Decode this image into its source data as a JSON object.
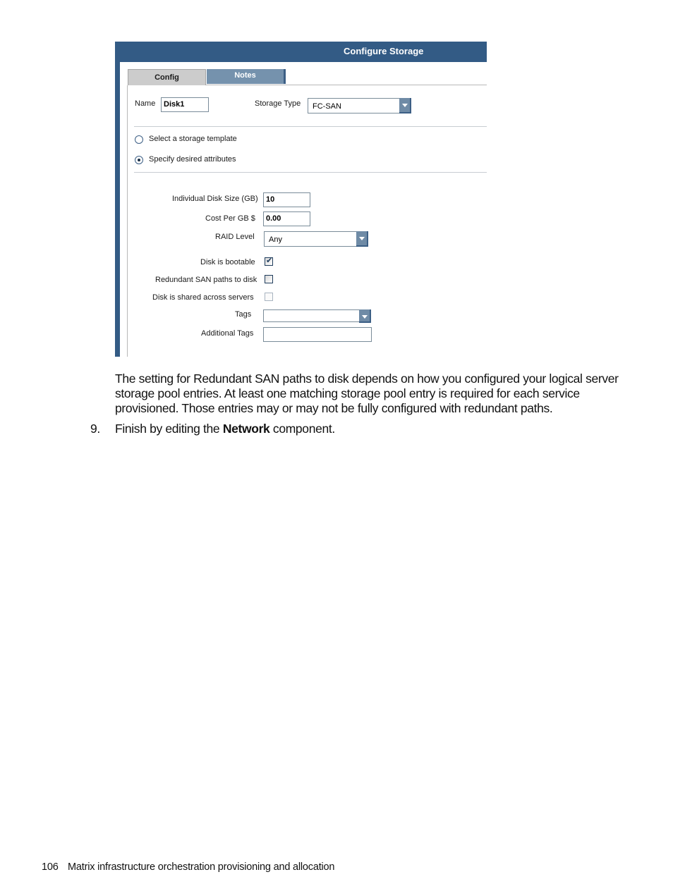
{
  "panel": {
    "title": "Configure Storage",
    "tabs": [
      {
        "label": "Config",
        "active": true
      },
      {
        "label": "Notes",
        "active": false
      }
    ],
    "name_label": "Name",
    "name_value": "Disk1",
    "storage_type_label": "Storage Type",
    "storage_type_value": "FC-SAN",
    "radios": [
      {
        "label": "Select a storage template",
        "selected": false
      },
      {
        "label": "Specify desired attributes",
        "selected": true
      }
    ],
    "disk_size_label": "Individual Disk Size (GB)",
    "disk_size_value": "10",
    "cost_label": "Cost Per GB $",
    "cost_value": "0.00",
    "raid_label": "RAID Level",
    "raid_value": "Any",
    "checkboxes": [
      {
        "label": "Disk is bootable",
        "checked": true,
        "enabled": true
      },
      {
        "label": "Redundant SAN paths to disk",
        "checked": false,
        "enabled": true
      },
      {
        "label": "Disk is shared across servers",
        "checked": false,
        "enabled": false
      }
    ],
    "tags_label": "Tags",
    "tags_value": "",
    "additional_tags_label": "Additional Tags",
    "additional_tags_value": ""
  },
  "document": {
    "paragraph": "The setting for Redundant SAN paths to disk depends on how you configured your logical server storage pool entries. At least one matching storage pool entry is required for each service provisioned. Those entries may or may not be fully configured with redundant paths.",
    "step_number": "9.",
    "step_prefix": "Finish by editing the ",
    "step_bold": "Network",
    "step_suffix": " component.",
    "footer_page": "106",
    "footer_title": "Matrix infrastructure orchestration provisioning and allocation"
  },
  "colors": {
    "header_blue": "#335b85",
    "notes_tab": "#7592ad",
    "config_tab": "#cccccc"
  }
}
